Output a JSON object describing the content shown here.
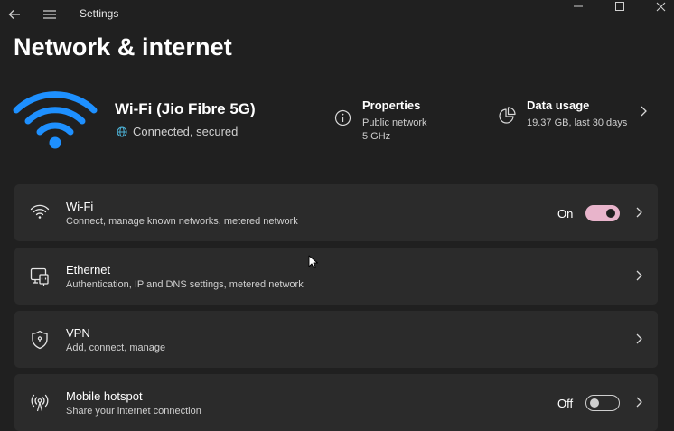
{
  "window": {
    "title": "Settings",
    "icons": [
      "back-arrow-icon",
      "hamburger-menu-icon",
      "minimize-icon",
      "maximize-icon",
      "close-icon"
    ]
  },
  "page": {
    "title": "Network & internet"
  },
  "hero": {
    "network_name": "Wi-Fi (Jio Fibre 5G)",
    "status": "Connected, secured",
    "properties": {
      "title": "Properties",
      "line1": "Public network",
      "line2": "5 GHz"
    },
    "data_usage": {
      "title": "Data usage",
      "line1": "19.37 GB, last 30 days"
    }
  },
  "cards": {
    "wifi": {
      "title": "Wi-Fi",
      "subtitle": "Connect, manage known networks, metered network",
      "toggle_label": "On",
      "toggle_state": true
    },
    "ethernet": {
      "title": "Ethernet",
      "subtitle": "Authentication, IP and DNS settings, metered network"
    },
    "vpn": {
      "title": "VPN",
      "subtitle": "Add, connect, manage"
    },
    "hotspot": {
      "title": "Mobile hotspot",
      "subtitle": "Share your internet connection",
      "toggle_label": "Off",
      "toggle_state": false
    }
  },
  "colors": {
    "background": "#202020",
    "card": "#2b2b2b",
    "accent_wifi": "#1e90ff",
    "toggle_on": "#e8b4cb"
  }
}
